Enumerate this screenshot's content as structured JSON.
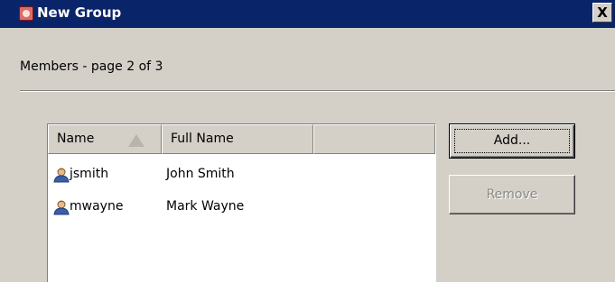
{
  "window": {
    "title": "New Group",
    "close_label": "X"
  },
  "section": {
    "header": "Members - page 2 of 3"
  },
  "members_list": {
    "columns": [
      "Name",
      "Full Name",
      ""
    ],
    "sort_column": "Name",
    "sort_direction": "ascending",
    "rows": [
      {
        "login": "jsmith",
        "full_name": "John Smith",
        "icon": "user-icon"
      },
      {
        "login": "mwayne",
        "full_name": "Mark Wayne",
        "icon": "user-icon"
      }
    ]
  },
  "buttons": {
    "add_label": "Add...",
    "remove_label": "Remove",
    "remove_enabled": false
  },
  "colors": {
    "titlebar": "#0a246a",
    "dialog_bg": "#d4d0c8",
    "disabled_text": "#8c8a84"
  }
}
